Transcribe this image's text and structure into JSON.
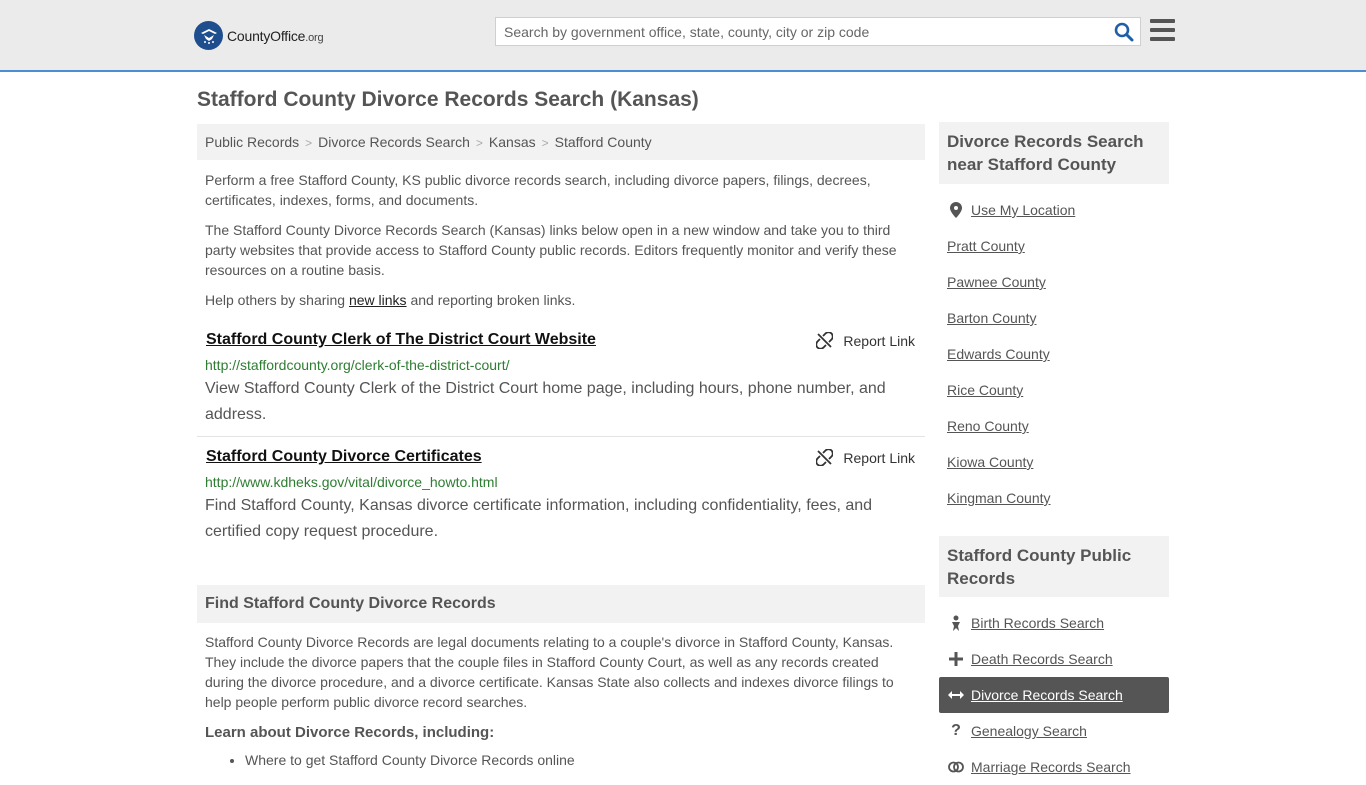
{
  "header": {
    "logo_text_main": "CountyOffice",
    "logo_text_tld": ".org",
    "search_placeholder": "Search by government office, state, county, city or zip code"
  },
  "page_title": "Stafford County Divorce Records Search (Kansas)",
  "breadcrumb": [
    "Public Records",
    "Divorce Records Search",
    "Kansas",
    "Stafford County"
  ],
  "intro": {
    "p1": "Perform a free Stafford County, KS public divorce records search, including divorce papers, filings, decrees, certificates, indexes, forms, and documents.",
    "p2": "The Stafford County Divorce Records Search (Kansas) links below open in a new window and take you to third party websites that provide access to Stafford County public records. Editors frequently monitor and verify these resources on a routine basis.",
    "p3_before": "Help others by sharing ",
    "p3_link": "new links",
    "p3_after": " and reporting broken links."
  },
  "results": [
    {
      "title": "Stafford County Clerk of The District Court Website",
      "url": "http://staffordcounty.org/clerk-of-the-district-court/",
      "description": "View Stafford County Clerk of the District Court home page, including hours, phone number, and address.",
      "report_label": "Report Link"
    },
    {
      "title": "Stafford County Divorce Certificates",
      "url": "http://www.kdheks.gov/vital/divorce_howto.html",
      "description": "Find Stafford County, Kansas divorce certificate information, including confidentiality, fees, and certified copy request procedure.",
      "report_label": "Report Link"
    }
  ],
  "find_section": {
    "heading": "Find Stafford County Divorce Records",
    "text": "Stafford County Divorce Records are legal documents relating to a couple's divorce in Stafford County, Kansas. They include the divorce papers that the couple files in Stafford County Court, as well as any records created during the divorce procedure, and a divorce certificate. Kansas State also collects and indexes divorce filings to help people perform public divorce record searches.",
    "learn_heading": "Learn about Divorce Records, including:",
    "bullets": [
      "Where to get Stafford County Divorce Records online"
    ]
  },
  "sidebar": {
    "nearby_heading": "Divorce Records Search near Stafford County",
    "use_location": "Use My Location",
    "nearby": [
      "Pratt County",
      "Pawnee County",
      "Barton County",
      "Edwards County",
      "Rice County",
      "Reno County",
      "Kiowa County",
      "Kingman County"
    ],
    "public_heading": "Stafford County Public Records",
    "public_links": [
      {
        "label": "Birth Records Search",
        "icon": "baby-icon"
      },
      {
        "label": "Death Records Search",
        "icon": "cross-icon"
      },
      {
        "label": "Divorce Records Search",
        "icon": "arrows-icon",
        "active": true
      },
      {
        "label": "Genealogy Search",
        "icon": "question-icon"
      },
      {
        "label": "Marriage Records Search",
        "icon": "rings-icon"
      }
    ]
  },
  "colors": {
    "accent_border": "#4a8fd4",
    "url_green": "#2e7d32",
    "active_bg": "#555555"
  }
}
